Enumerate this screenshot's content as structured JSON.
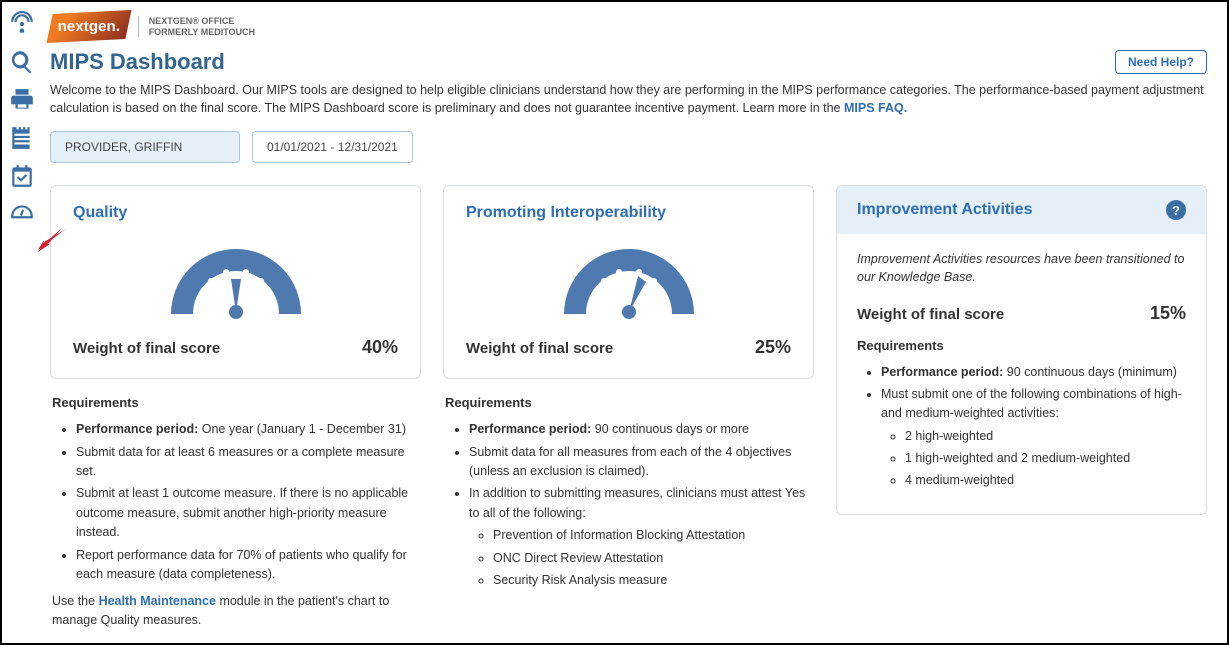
{
  "brand": {
    "logo_text": "nextgen.",
    "sub_line1": "NEXTGEN® OFFICE",
    "sub_line2": "FORMERLY MEDITOUCH"
  },
  "header": {
    "title": "MIPS Dashboard",
    "help_button": "Need Help?",
    "welcome_pre": "Welcome to the MIPS Dashboard. Our MIPS tools are designed to help eligible clinicians understand how they are performing in the MIPS performance categories. The performance-based payment adjustment calculation is based on the final score. The MIPS Dashboard score is preliminary and does not guarantee incentive payment. Learn more in the ",
    "welcome_link": "MIPS FAQ."
  },
  "filters": {
    "provider": "PROVIDER, GRIFFIN",
    "date_range": "01/01/2021 - 12/31/2021"
  },
  "quality": {
    "title": "Quality",
    "weight_label": "Weight of final score",
    "weight_value": "40%",
    "req_heading": "Requirements",
    "perf_label": "Performance period:",
    "perf_text": " One year (January 1 - December 31)",
    "bullets": [
      "Submit data for at least 6 measures or a complete measure set.",
      "Submit at least 1 outcome measure. If there is no applicable outcome measure, submit another high-priority measure instead.",
      "Report performance data for 70% of patients who qualify for each measure (data completeness)."
    ],
    "footnote_pre": "Use the ",
    "footnote_link": "Health Maintenance",
    "footnote_post": " module in the patient's chart to manage Quality measures."
  },
  "interop": {
    "title": "Promoting Interoperability",
    "weight_label": "Weight of final score",
    "weight_value": "25%",
    "req_heading": "Requirements",
    "perf_label": "Performance period:",
    "perf_text": " 90 continuous days or more",
    "bullets": [
      "Submit data for all measures from each of the 4 objectives (unless an exclusion is claimed).",
      "In addition to submitting measures, clinicians must attest Yes to all of the following:"
    ],
    "sub_bullets": [
      "Prevention of Information Blocking Attestation",
      "ONC Direct Review Attestation",
      "Security Risk Analysis measure"
    ]
  },
  "improvement": {
    "title": "Improvement Activities",
    "note": "Improvement Activities resources have been transitioned to our Knowledge Base.",
    "weight_label": "Weight of final score",
    "weight_value": "15%",
    "req_heading": "Requirements",
    "perf_label": "Performance period:",
    "perf_text": " 90 continuous days (minimum)",
    "bullet_main": "Must submit one of the following combinations of high- and medium-weighted activities:",
    "sub_bullets": [
      "2 high-weighted",
      "1 high-weighted and 2 medium-weighted",
      "4 medium-weighted"
    ]
  }
}
